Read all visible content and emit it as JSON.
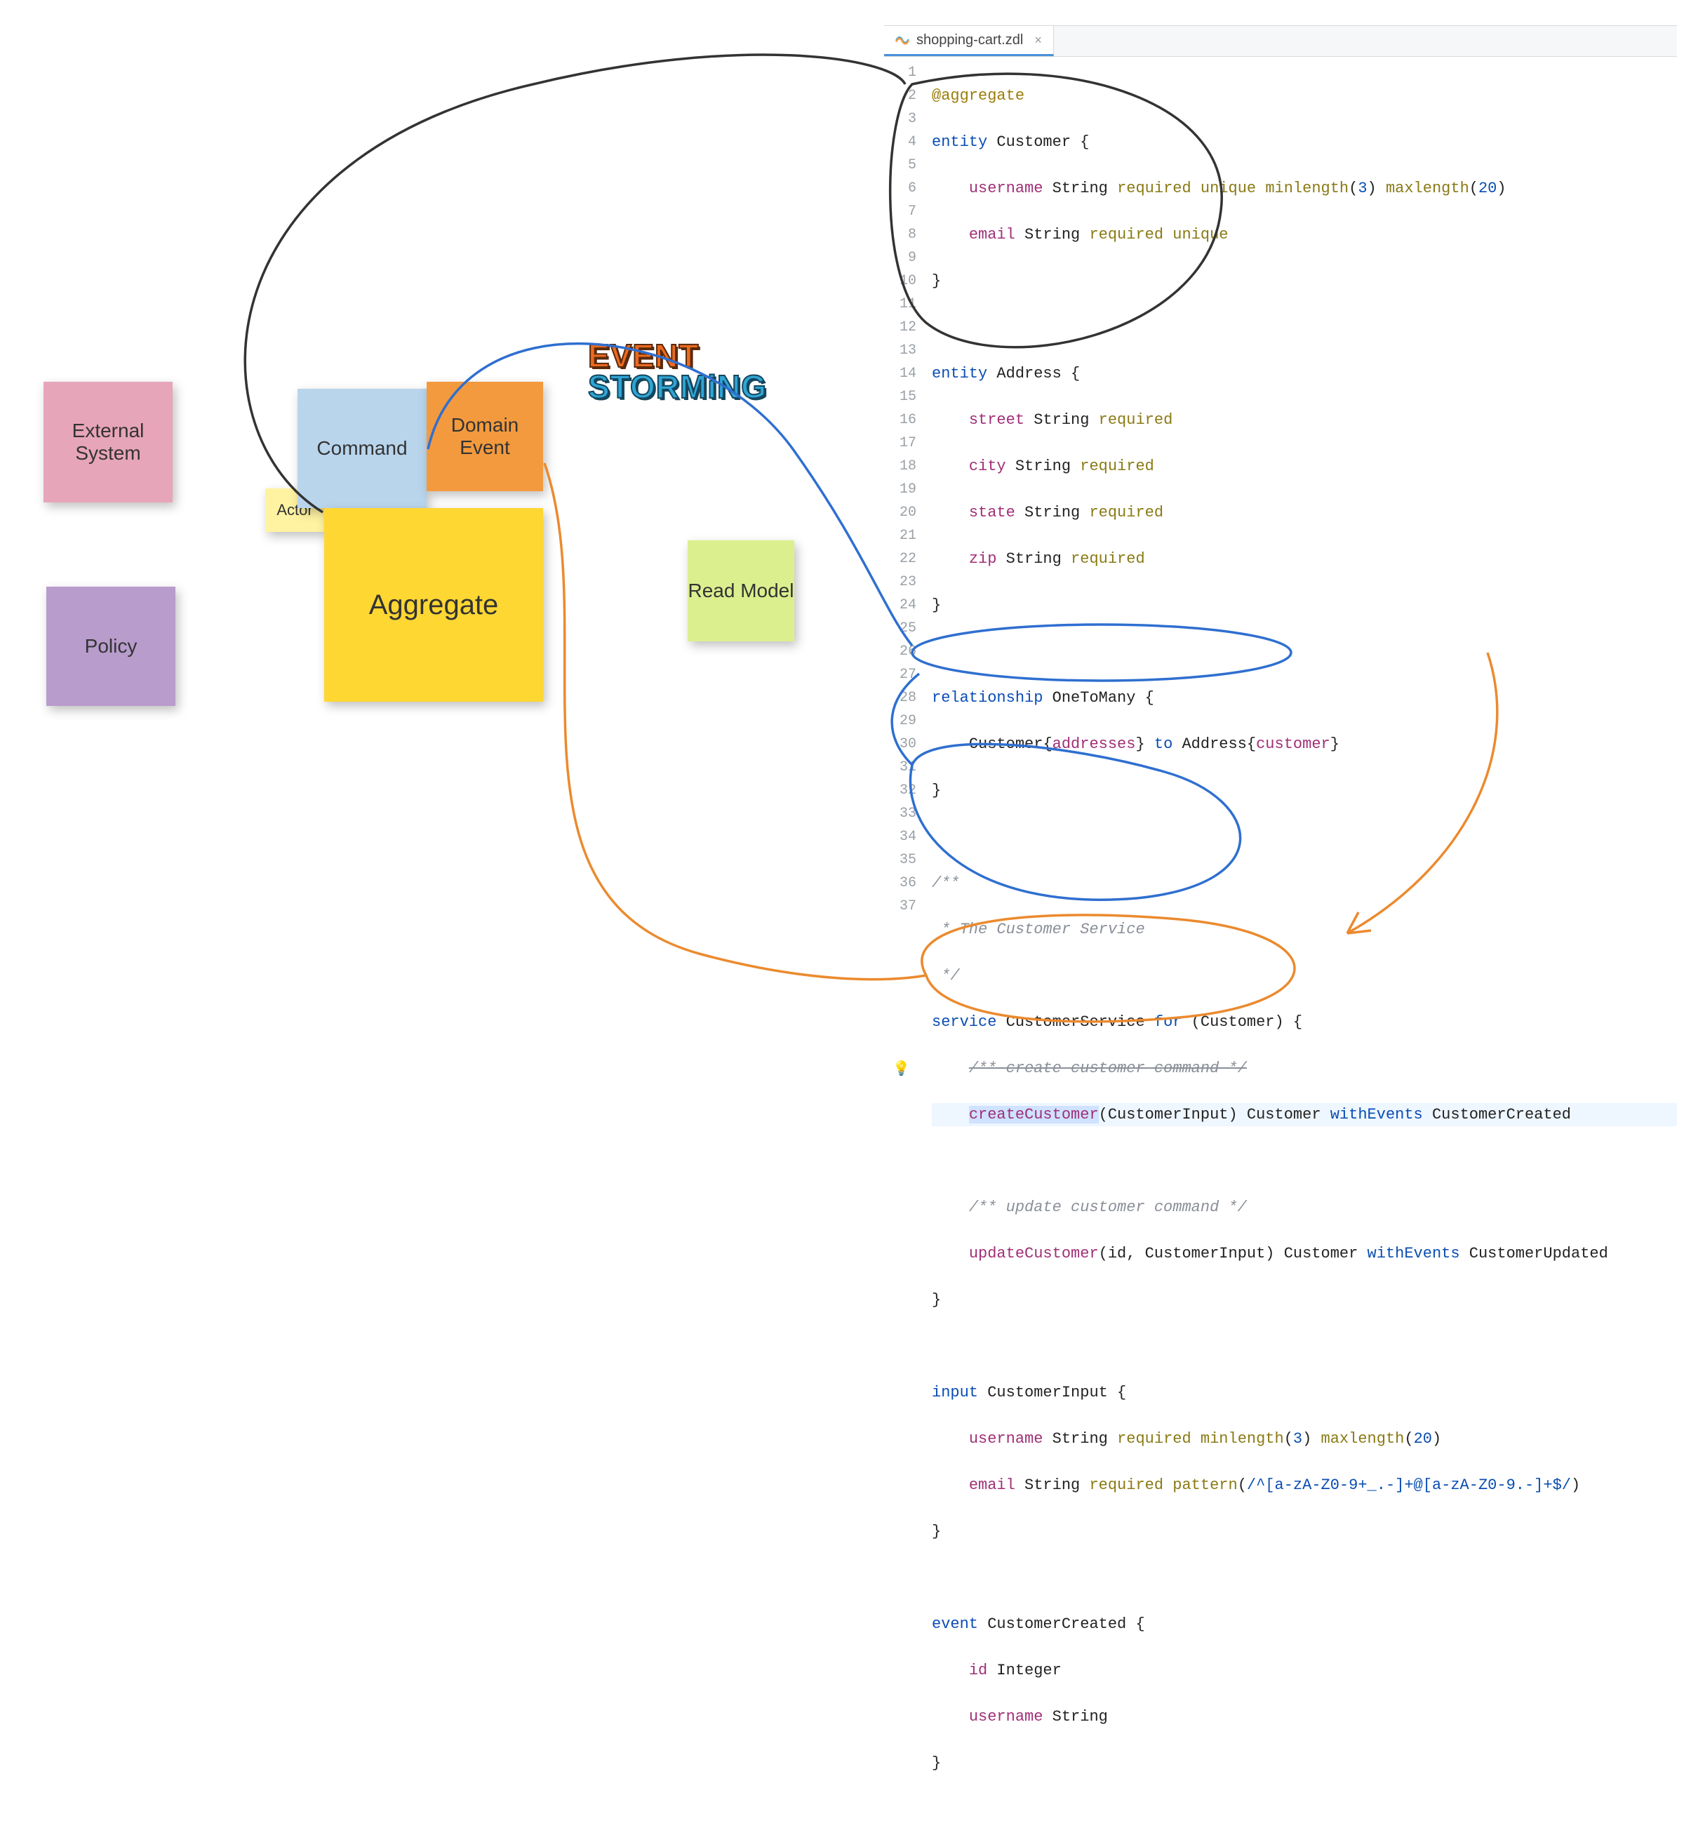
{
  "stickies": {
    "external_system": "External System",
    "policy": "Policy",
    "actor": "Actor",
    "command": "Command",
    "domain_event": "Domain Event",
    "aggregate": "Aggregate",
    "read_model": "Read Model"
  },
  "event_storming": {
    "line1": "EVENT",
    "line2": "STORMiNG"
  },
  "editor": {
    "tab_filename": "shopping-cart.zdl",
    "line_numbers": [
      "1",
      "2",
      "3",
      "4",
      "5",
      "6",
      "7",
      "8",
      "9",
      "10",
      "11",
      "12",
      "13",
      "14",
      "15",
      "16",
      "17",
      "18",
      "19",
      "20",
      "21",
      "22",
      "23",
      "24",
      "25",
      "26",
      "27",
      "28",
      "29",
      "30",
      "31",
      "32",
      "33",
      "34",
      "35",
      "36",
      "37"
    ],
    "code": {
      "l1_annotation": "@aggregate",
      "l2_kw": "entity",
      "l2_name": "Customer",
      "l3_field": "username",
      "l3_type": "String",
      "l3_c1": "required",
      "l3_c2": "unique",
      "l3_c3": "minlength",
      "l3_c3n": "3",
      "l3_c4": "maxlength",
      "l3_c4n": "20",
      "l4_field": "email",
      "l4_type": "String",
      "l4_c1": "required",
      "l4_c2": "unique",
      "l7_kw": "entity",
      "l7_name": "Address",
      "l8_field": "street",
      "l8_type": "String",
      "l8_c1": "required",
      "l9_field": "city",
      "l9_type": "String",
      "l9_c1": "required",
      "l10_field": "state",
      "l10_type": "String",
      "l10_c1": "required",
      "l11_field": "zip",
      "l11_type": "String",
      "l11_c1": "required",
      "l14_kw": "relationship",
      "l14_name": "OneToMany",
      "l15_a": "Customer",
      "l15_af": "addresses",
      "l15_to": "to",
      "l15_b": "Address",
      "l15_bf": "customer",
      "l18": "/**",
      "l19": " * The Customer Service",
      "l20": " */",
      "l21_kw": "service",
      "l21_name": "CustomerService",
      "l21_for": "for",
      "l21_target": "Customer",
      "l22": "/** create customer command */",
      "l23_method": "createCustomer",
      "l23_input": "CustomerInput",
      "l23_ret": "Customer",
      "l23_with": "withEvents",
      "l23_evt": "CustomerCreated",
      "l25": "/** update customer command */",
      "l26_method": "updateCustomer",
      "l26_args": "id, CustomerInput",
      "l26_ret": "Customer",
      "l26_with": "withEvents",
      "l26_evt": "CustomerUpdated",
      "l29_kw": "input",
      "l29_name": "CustomerInput",
      "l30_field": "username",
      "l30_type": "String",
      "l30_c1": "required",
      "l30_c2": "minlength",
      "l30_c2n": "3",
      "l30_c3": "maxlength",
      "l30_c3n": "20",
      "l31_field": "email",
      "l31_type": "String",
      "l31_c1": "required",
      "l31_c2": "pattern",
      "l31_regex": "/^[a-zA-Z0-9+_.-]+@[a-zA-Z0-9.-]+$/",
      "l34_kw": "event",
      "l34_name": "CustomerCreated",
      "l35_field": "id",
      "l35_type": "Integer",
      "l36_field": "username",
      "l36_type": "String"
    }
  }
}
